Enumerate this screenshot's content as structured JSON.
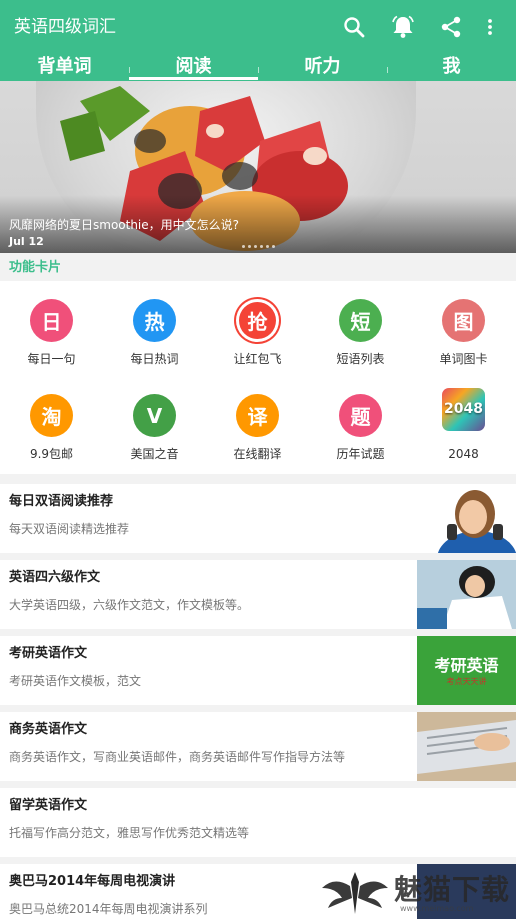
{
  "app": {
    "title": "英语四级词汇"
  },
  "toolbar": {
    "icons": [
      "search-icon",
      "alarm-bell-icon",
      "share-icon",
      "more-vert-icon"
    ]
  },
  "tabs": [
    {
      "label": "背单词"
    },
    {
      "label": "阅读",
      "active": true
    },
    {
      "label": "听力"
    },
    {
      "label": "我"
    }
  ],
  "banner": {
    "caption": "风靡网络的夏日smoothie，用中文怎么说?",
    "date": "Jul 12",
    "page_dots": 6
  },
  "section": {
    "label": "功能卡片"
  },
  "features": [
    {
      "glyph": "日",
      "label": "每日一句",
      "color": "#f0507a"
    },
    {
      "glyph": "热",
      "label": "每日热词",
      "color": "#2196f3"
    },
    {
      "glyph": "抢",
      "label": "让红包飞",
      "color": "#f44336"
    },
    {
      "glyph": "短",
      "label": "短语列表",
      "color": "#4caf50"
    },
    {
      "glyph": "图",
      "label": "单词图卡",
      "color": "#e57373"
    },
    {
      "glyph": "淘",
      "label": "9.9包邮",
      "color": "#ff9800"
    },
    {
      "glyph": "V",
      "label": "美国之音",
      "color": "#43a047"
    },
    {
      "glyph": "译",
      "label": "在线翻译",
      "color": "#ff9800"
    },
    {
      "glyph": "题",
      "label": "历年试题",
      "color": "#f0507a"
    },
    {
      "glyph": "2048",
      "label": "2048",
      "color": ""
    }
  ],
  "articles": [
    {
      "title": "每日双语阅读推荐",
      "desc": "每天双语阅读精选推荐"
    },
    {
      "title": "英语四六级作文",
      "desc": "大学英语四级，六级作文范文，作文模板等。"
    },
    {
      "title": "考研英语作文",
      "desc": "考研英语作文模板，范文",
      "thumb_title": "考研英语",
      "thumb_sub": "考点天天讲"
    },
    {
      "title": "商务英语作文",
      "desc": "商务英语作文，写商业英语邮件，商务英语邮件写作指导方法等"
    },
    {
      "title": "留学英语作文",
      "desc": "托福写作高分范文，雅思写作优秀范文精选等"
    },
    {
      "title": "奥巴马2014年每周电视演讲",
      "desc": "奥巴马总统2014年每周电视演讲系列"
    }
  ],
  "watermark": {
    "text": "魅猫下载",
    "url": "www.meimao.com"
  }
}
